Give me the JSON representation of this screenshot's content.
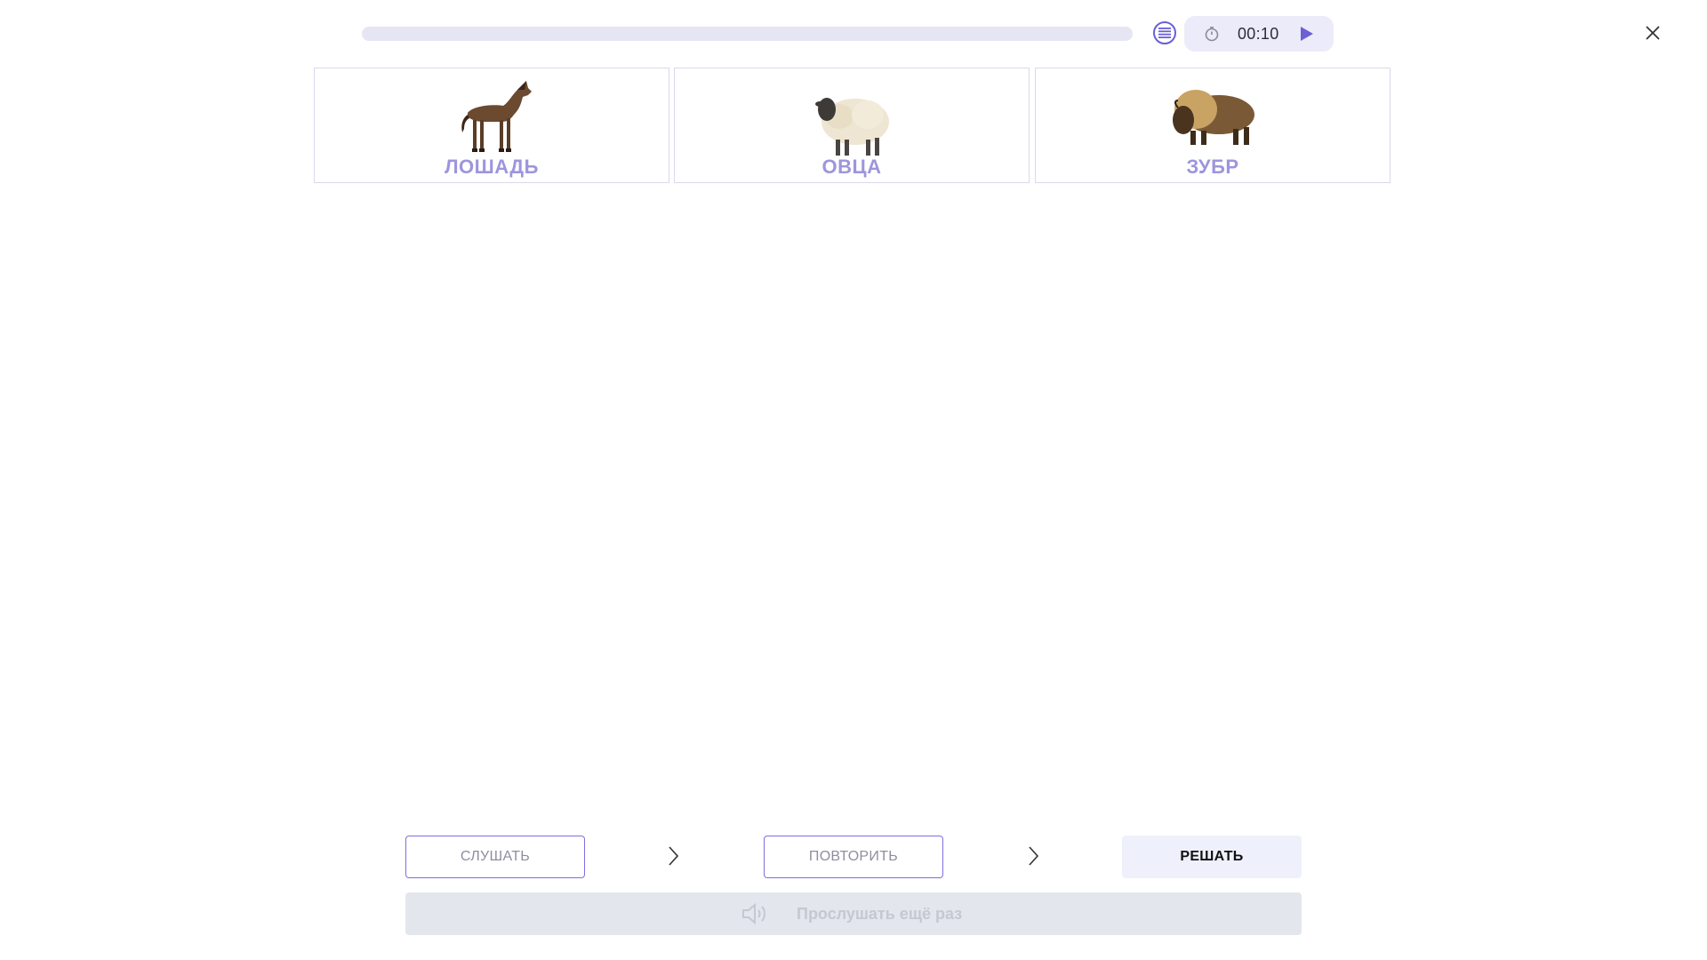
{
  "progress": {
    "value": 0.0
  },
  "timer": {
    "time": "00:10"
  },
  "cards": [
    {
      "label": "ЛОШАДЬ",
      "image": "horse"
    },
    {
      "label": "ОВЦА",
      "image": "sheep"
    },
    {
      "label": "ЗУБР",
      "image": "bison"
    }
  ],
  "steps": {
    "listen": "СЛУШАТЬ",
    "repeat": "ПОВТОРИТЬ",
    "solve": "РЕШАТЬ"
  },
  "replay": {
    "label": "Прослушать ещё раз"
  },
  "colors": {
    "accent": "#6a5fd6",
    "card_label": "#9d95dd",
    "track": "#e6e5f3"
  }
}
